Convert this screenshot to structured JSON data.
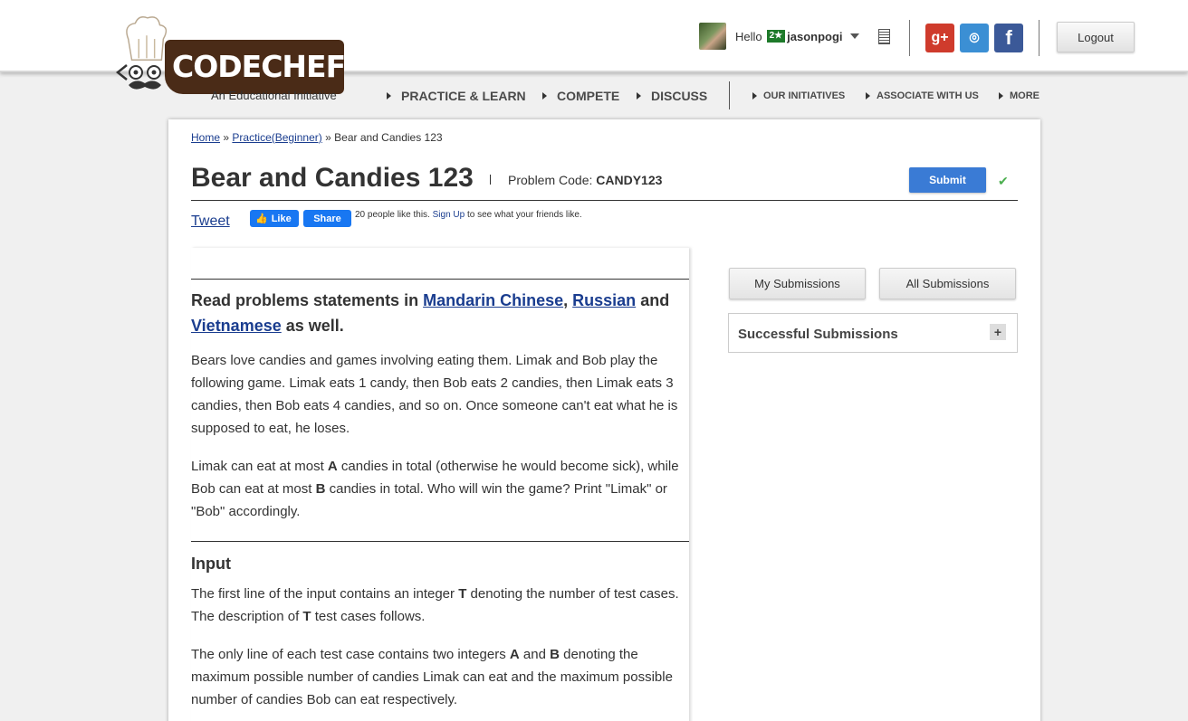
{
  "header": {
    "brand": "CODECHEF",
    "tagline": "An Educational Initiative",
    "greeting": "Hello",
    "star_badge": "2★",
    "username": "jasonpogi",
    "logout_label": "Logout",
    "social": {
      "google_plus": "g+",
      "github": "⌾",
      "facebook": "f"
    }
  },
  "nav": {
    "primary": [
      "PRACTICE & LEARN",
      "COMPETE",
      "DISCUSS"
    ],
    "secondary": [
      "OUR INITIATIVES",
      "ASSOCIATE WITH US",
      "MORE"
    ]
  },
  "breadcrumb": {
    "home": "Home",
    "sep": "»",
    "practice": "Practice(Beginner)",
    "current": "Bear and Candies 123"
  },
  "problem": {
    "title": "Bear and Candies 123",
    "code_label": "Problem Code:",
    "code": "CANDY123",
    "submit_label": "Submit"
  },
  "social_bar": {
    "tweet": "Tweet",
    "like": "Like",
    "share": "Share",
    "like_text_pre": "20 people like this.",
    "signup": "Sign Up",
    "like_text_post": "to see what your friends like."
  },
  "statement": {
    "lang_pre": "Read problems statements in",
    "lang1": "Mandarin Chinese",
    "comma": ",",
    "lang2": "Russian",
    "and": "and",
    "lang3": "Vietnamese",
    "lang_post": "as well.",
    "p1": "Bears love candies and games involving eating them. Limak and Bob play the following game. Limak eats 1 candy, then Bob eats 2 candies, then Limak eats 3 candies, then Bob eats 4 candies, and so on. Once someone can't eat what he is supposed to eat, he loses.",
    "p2_a": "Limak can eat at most",
    "p2_A": "A",
    "p2_b": "candies in total (otherwise he would become sick), while Bob can eat at most",
    "p2_B": "B",
    "p2_c": "candies in total. Who will win the game? Print \"Limak\" or \"Bob\" accordingly.",
    "input_title": "Input",
    "p3_a": "The first line of the input contains an integer",
    "p3_T": "T",
    "p3_b": "denoting the number of test cases. The description of",
    "p3_T2": "T",
    "p3_c": "test cases follows.",
    "p4_a": "The only line of each test case contains two integers",
    "p4_A": "A",
    "p4_and": "and",
    "p4_B": "B",
    "p4_b": "denoting the maximum possible number of candies Limak can eat and the maximum possible number of candies Bob can eat respectively."
  },
  "sidebar": {
    "my_submissions": "My Submissions",
    "all_submissions": "All Submissions",
    "successful_submissions": "Successful Submissions",
    "expand": "+"
  }
}
